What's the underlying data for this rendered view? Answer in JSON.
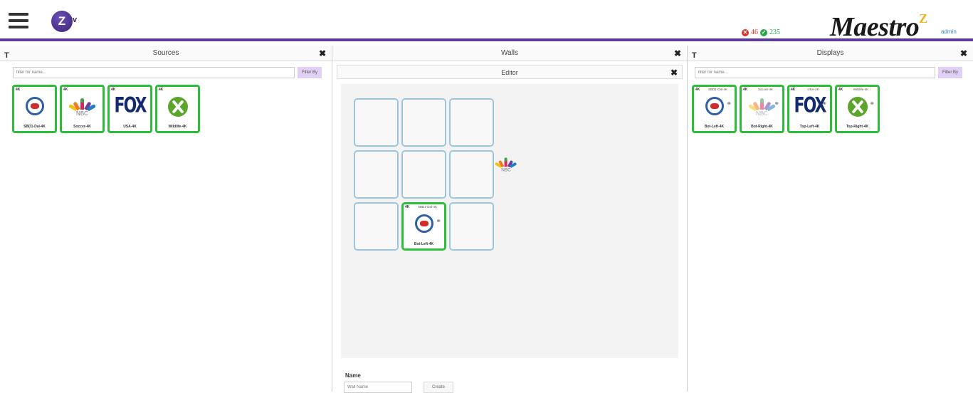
{
  "header": {
    "app_logo": "Z",
    "app_logo_suffix": "v",
    "status_error_count": "46",
    "status_ok_count": "235",
    "brand": "Maestro",
    "brand_sup": "Z",
    "user": "admin"
  },
  "sources": {
    "title": "Sources",
    "filter_placeholder": "filter for name...",
    "filter_button": "Filter By",
    "tiles": [
      {
        "badge": "4K",
        "label": "SBD1-Dal-4K",
        "logo": "nfl-network-logo"
      },
      {
        "badge": "4K",
        "label": "Soccer-4K",
        "logo": "nbc-logo"
      },
      {
        "badge": "4K",
        "label": "USA-4K",
        "logo": "fox-logo"
      },
      {
        "badge": "4K",
        "label": "Wildlife-4K",
        "logo": "xbox-logo"
      }
    ]
  },
  "walls": {
    "title": "Walls",
    "editor_title": "Editor",
    "placed_tile": {
      "badge": "4K",
      "top": "SBD1-Dal-4K",
      "label": "Bot-Left-4K"
    },
    "name_label": "Name",
    "name_placeholder": "Wall Name",
    "create_button": "Create"
  },
  "displays": {
    "title": "Displays",
    "filter_placeholder": "filter for name...",
    "filter_button": "Filter By",
    "tiles": [
      {
        "badge": "4K",
        "top": "SBD1-Dal-4K",
        "label": "Bot-Left-4K",
        "logo": "nfl-network-logo"
      },
      {
        "badge": "4K",
        "top": "Soccer-4K",
        "label": "Bot-Right-4K",
        "logo": "nbc-logo"
      },
      {
        "badge": "4K",
        "top": "USA-4K",
        "label": "Top-Left-4K",
        "logo": "fox-logo"
      },
      {
        "badge": "4K",
        "top": "Wildlife-4K",
        "label": "Top-Right-4K",
        "logo": "xbox-logo"
      }
    ]
  },
  "colors": {
    "accent": "#5b3d99",
    "tile_border": "#2ebd3b",
    "filter_button": "#e2cff5",
    "error": "#d9322e",
    "ok": "#2aa64a",
    "brand_sup": "#f0b21c"
  }
}
